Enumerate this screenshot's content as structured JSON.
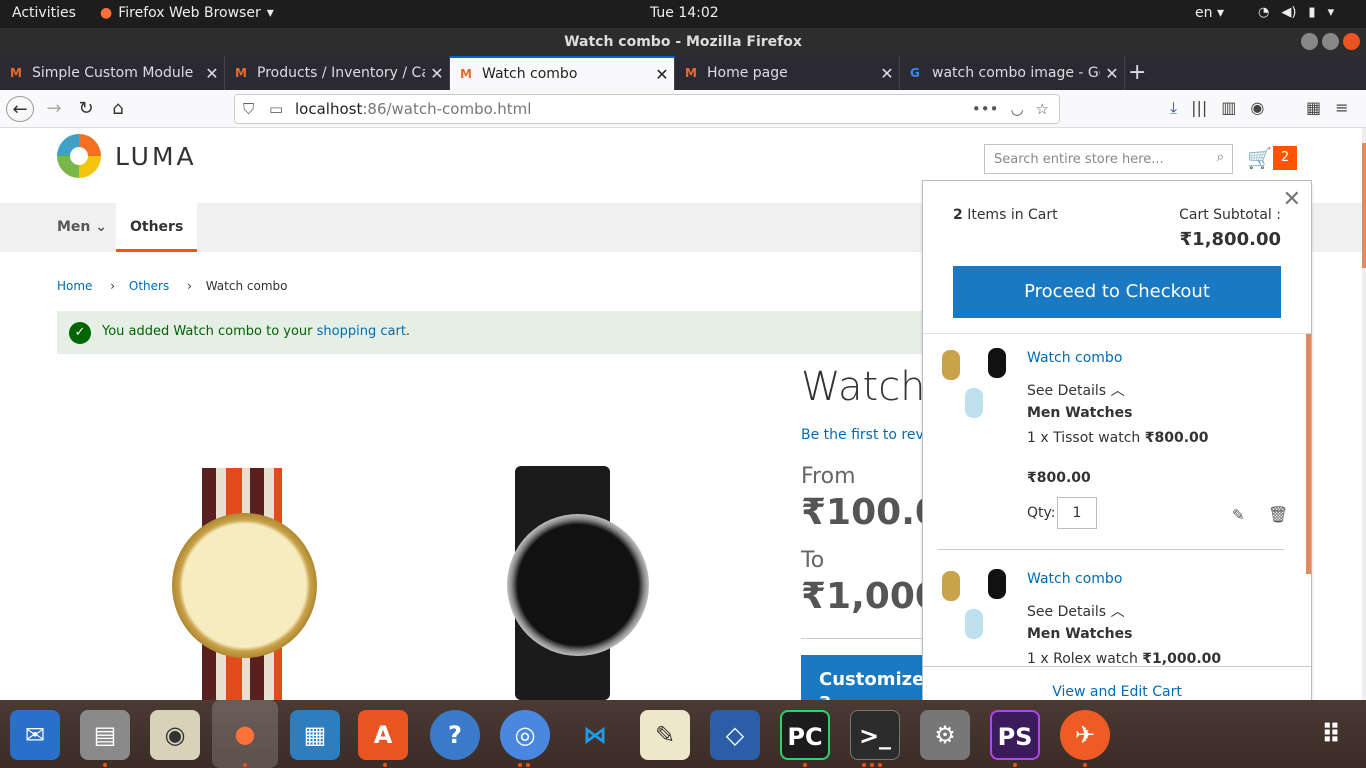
{
  "topbar": {
    "activities": "Activities",
    "app": "Firefox Web Browser",
    "clock": "Tue 14:02",
    "lang": "en"
  },
  "window": {
    "title": "Watch combo - Mozilla Firefox"
  },
  "tabs": [
    {
      "label": "Simple Custom Module"
    },
    {
      "label": "Products / Inventory / Ca"
    },
    {
      "label": "Watch combo"
    },
    {
      "label": "Home page"
    },
    {
      "label": "watch combo image - Go"
    }
  ],
  "url": {
    "host": "localhost",
    "rest": ":86/watch-combo.html"
  },
  "store": {
    "logo": "LUMA",
    "search_placeholder": "Search entire store here...",
    "cart_count": "2"
  },
  "nav": {
    "men": "Men",
    "others": "Others"
  },
  "breadcrumb": {
    "home": "Home",
    "others": "Others",
    "current": "Watch combo"
  },
  "message": {
    "prefix": "You added Watch combo to your ",
    "link": "shopping cart",
    "suffix": "."
  },
  "product": {
    "title": "Watch",
    "review": "Be the first to revie",
    "from_label": "From",
    "from_price": "₹100.00",
    "to_label": "To",
    "to_price": "₹1,000.",
    "customize": "Customize a"
  },
  "minicart": {
    "count": "2",
    "count_label": " Items in Cart",
    "subtotal_label": "Cart Subtotal :",
    "subtotal": "₹1,800.00",
    "checkout": "Proceed to Checkout",
    "view_edit": "View and Edit Cart",
    "items": [
      {
        "name": "Watch combo",
        "details": "See Details",
        "option": "Men Watches",
        "qty_text": "1 x Tissot watch ",
        "opt_price": "₹800.00",
        "price": "₹800.00",
        "qty_label": "Qty:",
        "qty": "1"
      },
      {
        "name": "Watch combo",
        "details": "See Details",
        "option": "Men Watches",
        "qty_text": "1 x Rolex watch ",
        "opt_price": "₹1,000.00"
      }
    ]
  }
}
